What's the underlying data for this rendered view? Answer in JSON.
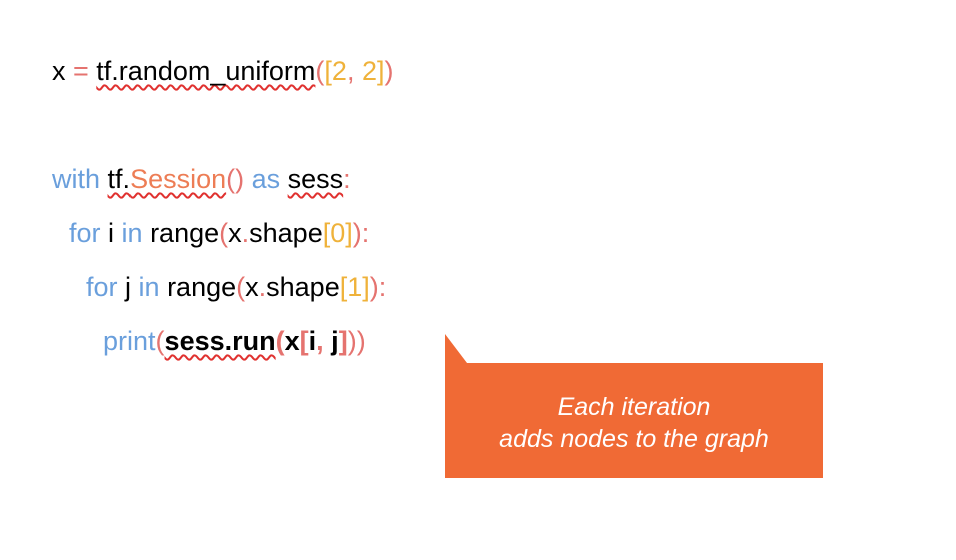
{
  "code": {
    "line1": {
      "x": "x",
      "eq": " = ",
      "tf_random": "tf.random_uniform",
      "paren_open": "(",
      "bracket_open": "[",
      "num_a": "2",
      "comma": ", ",
      "num_b": "2",
      "bracket_close": "]",
      "paren_close": ")"
    },
    "line2": {
      "with": "with ",
      "tf_dot": "tf.",
      "session": "Session",
      "parens": "()",
      "as": " as ",
      "sess": "sess",
      "colon": ":"
    },
    "line3": {
      "for": "for ",
      "i": "i",
      "in": " in ",
      "range": "range",
      "paren_open": "(",
      "x": "x",
      "dot": ".",
      "shape": "shape",
      "bracket_open": "[",
      "idx": "0",
      "bracket_close": "]",
      "end": "):"
    },
    "line4": {
      "for": "for ",
      "j": "j",
      "in": " in ",
      "range": "range",
      "paren_open": "(",
      "x": "x",
      "dot": ".",
      "shape": "shape",
      "bracket_open": "[",
      "idx": "1",
      "bracket_close": "]",
      "end": "):"
    },
    "line5": {
      "print": "print",
      "paren_open": "(",
      "sess_run": "sess.run",
      "paren_open2": "(",
      "x": "x",
      "bracket_open": "[",
      "i": "i",
      "comma": ", ",
      "j": "j",
      "bracket_close": "]",
      "paren_close2": ")",
      "paren_close": ")"
    }
  },
  "callout": {
    "line1": "Each iteration",
    "line2": "adds nodes to the graph"
  },
  "colors": {
    "keyword": "#6a9fdc",
    "operator": "#e5736f",
    "number": "#efb23a",
    "function": "#ed7d55",
    "callout_bg": "#f06a35",
    "callout_text": "#ffffff",
    "squiggle": "#e0312f"
  }
}
